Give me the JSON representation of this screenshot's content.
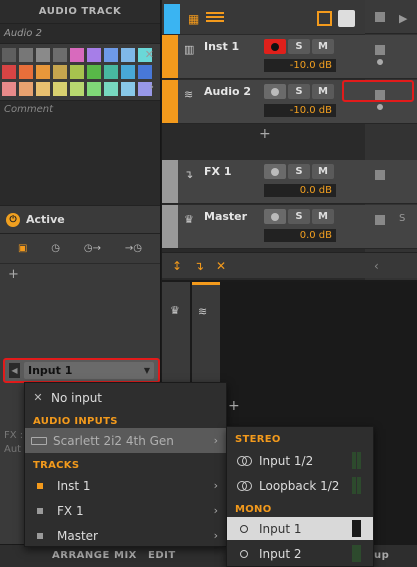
{
  "inspector": {
    "header": "AUDIO TRACK",
    "track_name": "Audio 2",
    "comment_placeholder": "Comment",
    "active_label": "Active",
    "input_selector": "Input 1",
    "fx_label": "FX :",
    "aut_label": "Aut",
    "palette_colors": [
      "#5f5f5f",
      "#777777",
      "#8a8a8a",
      "#6d6d6d",
      "#d86abd",
      "#a67ee8",
      "#6e9ae8",
      "#7fb8e8",
      "#6ad8d8",
      "#d84444",
      "#e86f3a",
      "#e8973a",
      "#c7a64e",
      "#a7c24e",
      "#58b848",
      "#48b8a0",
      "#48a8d8",
      "#4878d8",
      "#e88a8a",
      "#e8a270",
      "#e8c070",
      "#d8d070",
      "#b8d870",
      "#80d878",
      "#78d8c0",
      "#88c8e8",
      "#9898e8"
    ]
  },
  "tracks": [
    {
      "name": "Inst 1",
      "icon": "piano-icon",
      "color": "#f39a1c",
      "armed": true,
      "solo": "S",
      "mute": "M",
      "volume": "-10.0 dB"
    },
    {
      "name": "Audio 2",
      "icon": "waveform-icon",
      "color": "#f39a1c",
      "armed": false,
      "solo": "S",
      "mute": "M",
      "volume": "-10.0 dB"
    },
    {
      "name": "FX 1",
      "icon": "fx-return-icon",
      "color": "#9a9a9a",
      "armed": false,
      "solo": "S",
      "mute": "M",
      "volume": "0.0 dB"
    },
    {
      "name": "Master",
      "icon": "crown-icon",
      "color": "#9a9a9a",
      "armed": false,
      "solo": "S",
      "mute": "M",
      "volume": "0.0 dB"
    }
  ],
  "bottom_bar": {
    "arrange": "ARRANGE",
    "mix": "MIX",
    "edit": "EDIT",
    "right_label": "up"
  },
  "input_menu": {
    "no_input": "No input",
    "audio_inputs_header": "AUDIO INPUTS",
    "audio_device": "Scarlett 2i2 4th Gen",
    "tracks_header": "TRACKS",
    "track_items": [
      {
        "label": "Inst 1",
        "color": "#f39a1c"
      },
      {
        "label": "FX 1",
        "color": "#9a9a9a"
      },
      {
        "label": "Master",
        "color": "#9a9a9a"
      }
    ]
  },
  "device_submenu": {
    "stereo_header": "STEREO",
    "stereo_items": [
      "Input 1/2",
      "Loopback 1/2"
    ],
    "mono_header": "MONO",
    "mono_items": [
      "Input 1",
      "Input 2"
    ],
    "selected": "Input 1"
  }
}
